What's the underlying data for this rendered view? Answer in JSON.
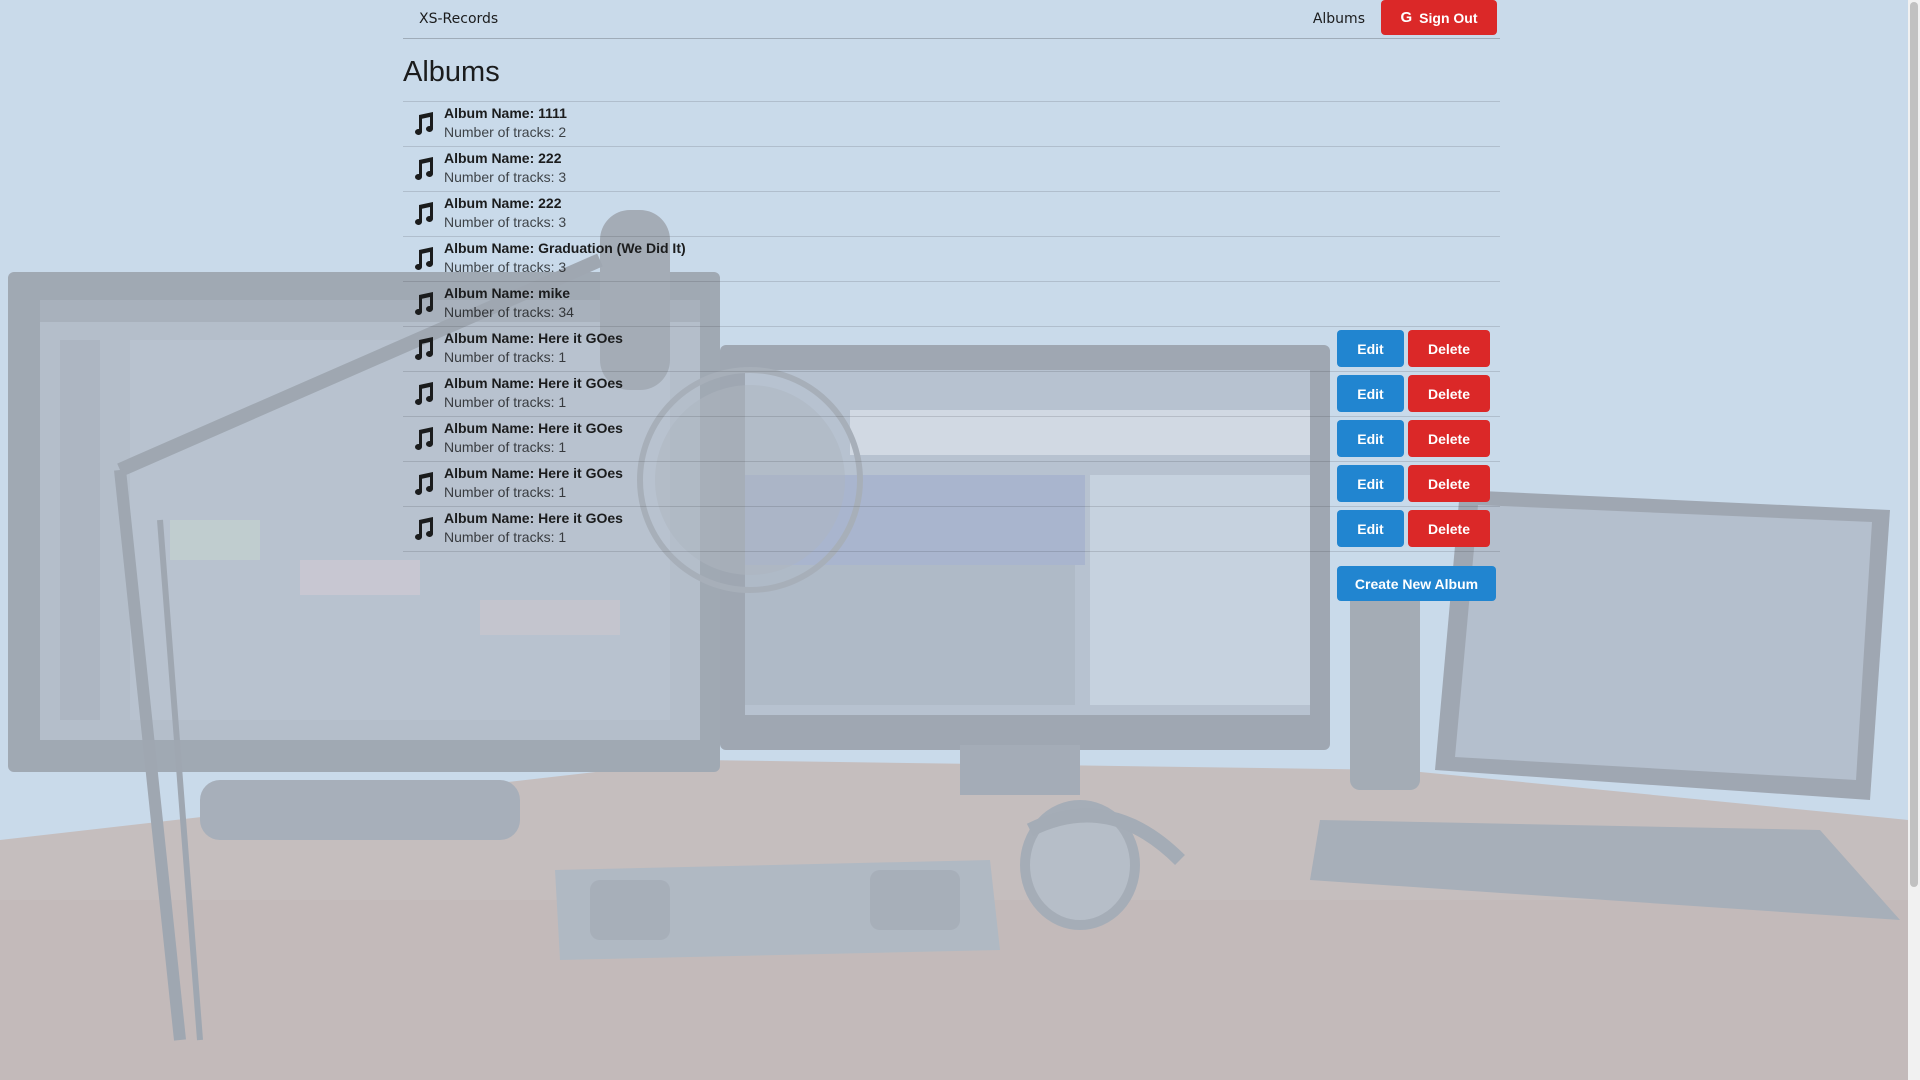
{
  "header": {
    "brand": "XS-Records",
    "albums_link": "Albums",
    "sign_out_icon": "G",
    "sign_out_label": "Sign Out"
  },
  "page": {
    "title": "Albums"
  },
  "albums": [
    {
      "name": "Album Name: 1111",
      "tracks": "Number of tracks: 2"
    },
    {
      "name": "Album Name: 222",
      "tracks": "Number of tracks: 3"
    },
    {
      "name": "Album Name: 222",
      "tracks": "Number of tracks: 3"
    },
    {
      "name": "Album Name: Graduation (We Did It)",
      "tracks": "Number of tracks: 3"
    },
    {
      "name": "Album Name: mike",
      "tracks": "Number of tracks: 34"
    },
    {
      "name": "Album Name: Here it GOes",
      "tracks": "Number of tracks: 1"
    },
    {
      "name": "Album Name: Here it GOes",
      "tracks": "Number of tracks: 1"
    },
    {
      "name": "Album Name: Here it GOes",
      "tracks": "Number of tracks: 1"
    },
    {
      "name": "Album Name: Here it GOes",
      "tracks": "Number of tracks: 1"
    },
    {
      "name": "Album Name: Here it GOes",
      "tracks": "Number of tracks: 1"
    }
  ],
  "actions": {
    "edit_label": "Edit",
    "delete_label": "Delete",
    "create_label": "Create New Album"
  },
  "colors": {
    "primary": "#2185d0",
    "danger": "#db2828",
    "background": "#c9daea"
  },
  "icons": {
    "album": "music-note-icon",
    "sign_out": "google-icon"
  }
}
